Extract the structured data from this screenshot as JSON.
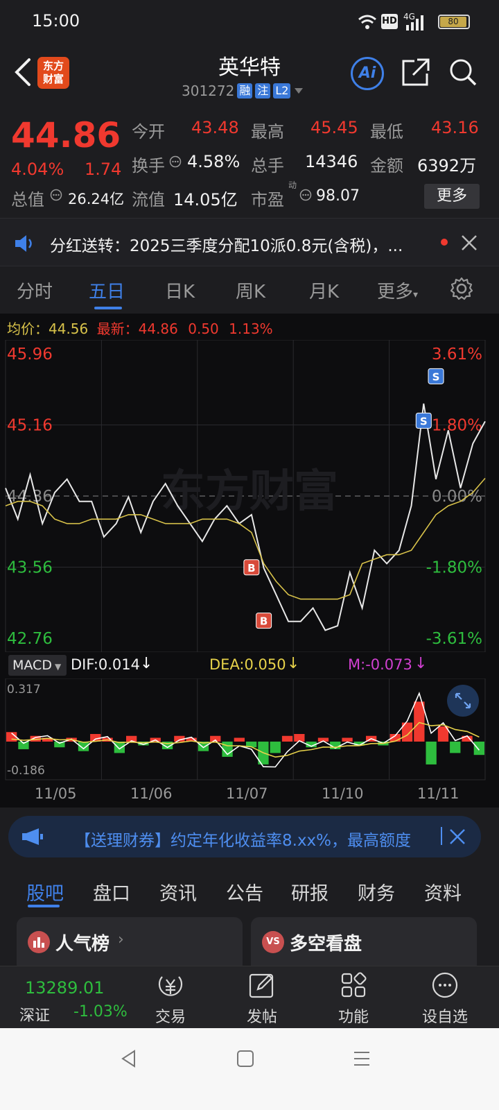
{
  "status": {
    "time": "15:00",
    "battery": "80",
    "hd": "HD",
    "net": "4G"
  },
  "header": {
    "title": "英华特",
    "code": "301272",
    "tags": [
      "融",
      "注",
      "L2"
    ],
    "logo_line1": "东方",
    "logo_line2": "财富",
    "ai_label": "Ai"
  },
  "quote": {
    "price": "44.86",
    "pct": "4.04%",
    "chg": "1.74",
    "open_label": "今开",
    "open": "43.48",
    "high_label": "最高",
    "high": "45.45",
    "low_label": "最低",
    "low": "43.16",
    "turnover_label": "换手",
    "turnover": "4.58%",
    "volume_label": "总手",
    "volume": "14346",
    "amount_label": "金额",
    "amount": "6392万",
    "mktcap_label": "总值",
    "mktcap": "26.24亿",
    "float_label": "流值",
    "float": "14.05亿",
    "pe_label": "市盈",
    "pe_sup": "动",
    "pe": "98.07",
    "more": "更多"
  },
  "notice": {
    "text": "分红送转：2025三季度分配10派0.8元(含税)，..."
  },
  "tabs": {
    "items": [
      "分时",
      "五日",
      "日K",
      "周K",
      "月K",
      "更多"
    ],
    "active": "五日"
  },
  "chart_legend": {
    "avg_label": "均价：",
    "avg": "44.56",
    "last_label": "最新：",
    "last": "44.86",
    "chg": "0.50",
    "pct": "1.13%"
  },
  "chart_data": {
    "type": "line",
    "x": [
      "11/05",
      "11/06",
      "11/07",
      "11/10",
      "11/11"
    ],
    "price_axis": [
      "45.96",
      "45.16",
      "44.36",
      "43.56",
      "42.76"
    ],
    "pct_axis": [
      "3.61%",
      "1.80%",
      "0.00%",
      "-1.80%",
      "-3.61%"
    ],
    "ylim": [
      42.76,
      45.96
    ],
    "prev_close": 44.36,
    "series": [
      {
        "name": "价格",
        "values": [
          44.45,
          44.1,
          44.6,
          44.05,
          44.4,
          44.55,
          44.3,
          44.3,
          43.9,
          44.05,
          44.35,
          43.95,
          44.3,
          44.5,
          44.25,
          44.05,
          43.85,
          44.1,
          44.25,
          44.05,
          44.15,
          43.55,
          43.25,
          42.95,
          42.95,
          43.1,
          42.85,
          42.9,
          43.5,
          43.1,
          43.75,
          43.6,
          43.75,
          44.25,
          45.4,
          44.55,
          45.1,
          44.45,
          44.95,
          45.2
        ]
      },
      {
        "name": "均价",
        "values": [
          44.25,
          44.3,
          44.3,
          44.25,
          44.1,
          44.05,
          44.05,
          44.1,
          44.1,
          44.1,
          44.15,
          44.15,
          44.1,
          44.05,
          44.05,
          44.05,
          44.1,
          44.1,
          44.1,
          44.05,
          43.95,
          43.6,
          43.4,
          43.25,
          43.2,
          43.2,
          43.2,
          43.2,
          43.25,
          43.6,
          43.65,
          43.7,
          43.7,
          43.75,
          43.95,
          44.15,
          44.25,
          44.3,
          44.4,
          44.56
        ]
      }
    ],
    "signals": [
      "B",
      "B",
      "S",
      "S"
    ],
    "macd": {
      "label": "MACD",
      "dif": "DIF:0.014",
      "dea": "DEA:0.050",
      "m": "M:-0.073",
      "top": "0.317",
      "bottom": "-0.186",
      "hist": [
        0.05,
        -0.04,
        0.03,
        0.02,
        -0.03,
        0.02,
        -0.05,
        0.04,
        0.02,
        -0.06,
        0.03,
        -0.02,
        0.02,
        -0.04,
        0.03,
        0.02,
        -0.05,
        0.03,
        -0.08,
        0.02,
        -0.03,
        -0.12,
        -0.06,
        0.03,
        0.04,
        -0.03,
        0.02,
        -0.04,
        0.02,
        -0.02,
        0.03,
        -0.02,
        0.04,
        0.1,
        0.21,
        -0.12,
        0.08,
        -0.06,
        0.03,
        -0.07
      ]
    },
    "colors": {
      "up": "#f0392f",
      "down": "#2ebd3e",
      "price": "#e8e8e8",
      "avg": "#d8c24a",
      "dif": "#ffffff",
      "dea": "#e7d24a"
    }
  },
  "promo": {
    "text": "【送理财券】约定年化收益率8.xx%，最高额度"
  },
  "bottom_tabs": {
    "items": [
      "股吧",
      "盘口",
      "资讯",
      "公告",
      "研报",
      "财务",
      "资料"
    ],
    "active": "股吧"
  },
  "cards": {
    "left": "人气榜",
    "right": "多空看盘"
  },
  "bottom_nav": {
    "index_value": "13289.01",
    "index_name": "深证",
    "index_pct": "-1.03%",
    "trade": "交易",
    "post": "发帖",
    "func": "功能",
    "watch": "设自选"
  }
}
